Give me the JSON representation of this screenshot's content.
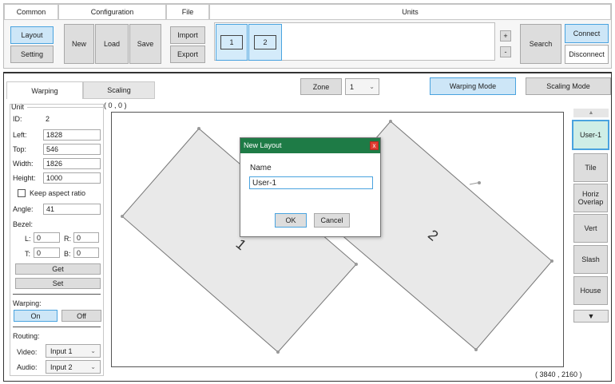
{
  "ribbon": {
    "groups": {
      "common": "Common",
      "configuration": "Configuration",
      "file": "File",
      "units": "Units"
    },
    "buttons": {
      "layout": "Layout",
      "setting": "Setting",
      "new": "New",
      "load": "Load",
      "save": "Save",
      "import": "Import",
      "export": "Export",
      "plus": "+",
      "minus": "-",
      "search": "Search",
      "connect": "Connect",
      "disconnect": "Disconnect"
    },
    "units": [
      "1",
      "2"
    ]
  },
  "tabs": {
    "warping": "Warping",
    "scaling": "Scaling"
  },
  "zone": {
    "label": "Zone",
    "value": "1"
  },
  "modes": {
    "warping": "Warping Mode",
    "scaling": "Scaling Mode"
  },
  "unit_panel": {
    "title": "Unit",
    "id_label": "ID:",
    "id_value": "2",
    "left_label": "Left:",
    "left_value": "1828",
    "top_label": "Top:",
    "top_value": "546",
    "width_label": "Width:",
    "width_value": "1826",
    "height_label": "Height:",
    "height_value": "1000",
    "keep_aspect": "Keep aspect ratio",
    "keep_aspect_checked": false,
    "angle_label": "Angle:",
    "angle_value": "41",
    "bezel_label": "Bezel:",
    "bezel": {
      "l_label": "L:",
      "l_value": "0",
      "r_label": "R:",
      "r_value": "0",
      "t_label": "T:",
      "t_value": "0",
      "b_label": "B:",
      "b_value": "0"
    },
    "get": "Get",
    "set": "Set",
    "warping_label": "Warping:",
    "on": "On",
    "off": "Off",
    "routing_label": "Routing:",
    "video_label": "Video:",
    "video_value": "Input 1",
    "audio_label": "Audio:",
    "audio_value": "Input 2"
  },
  "canvas": {
    "origin": "( 0 , 0 )",
    "extent": "( 3840 , 2160 )",
    "unit_labels": [
      "1",
      "2"
    ]
  },
  "dialog": {
    "title": "New Layout",
    "close": "x",
    "name_label": "Name",
    "name_value": "User-1",
    "ok": "OK",
    "cancel": "Cancel"
  },
  "layouts": {
    "scroll_up": "▲",
    "scroll_down": "▼",
    "items": [
      {
        "label": "User-1",
        "selected": true
      },
      {
        "label": "Tile",
        "selected": false
      },
      {
        "label": "Horiz Overlap",
        "selected": false
      },
      {
        "label": "Vert",
        "selected": false
      },
      {
        "label": "Slash",
        "selected": false
      },
      {
        "label": "House",
        "selected": false
      }
    ]
  },
  "colors": {
    "selected_fill": "#cde6f7",
    "selected_border": "#4aa3df",
    "dialog_title_bar": "#1e7b46",
    "close_button": "#e03c31",
    "unit_fill": "#e9e9e9"
  }
}
